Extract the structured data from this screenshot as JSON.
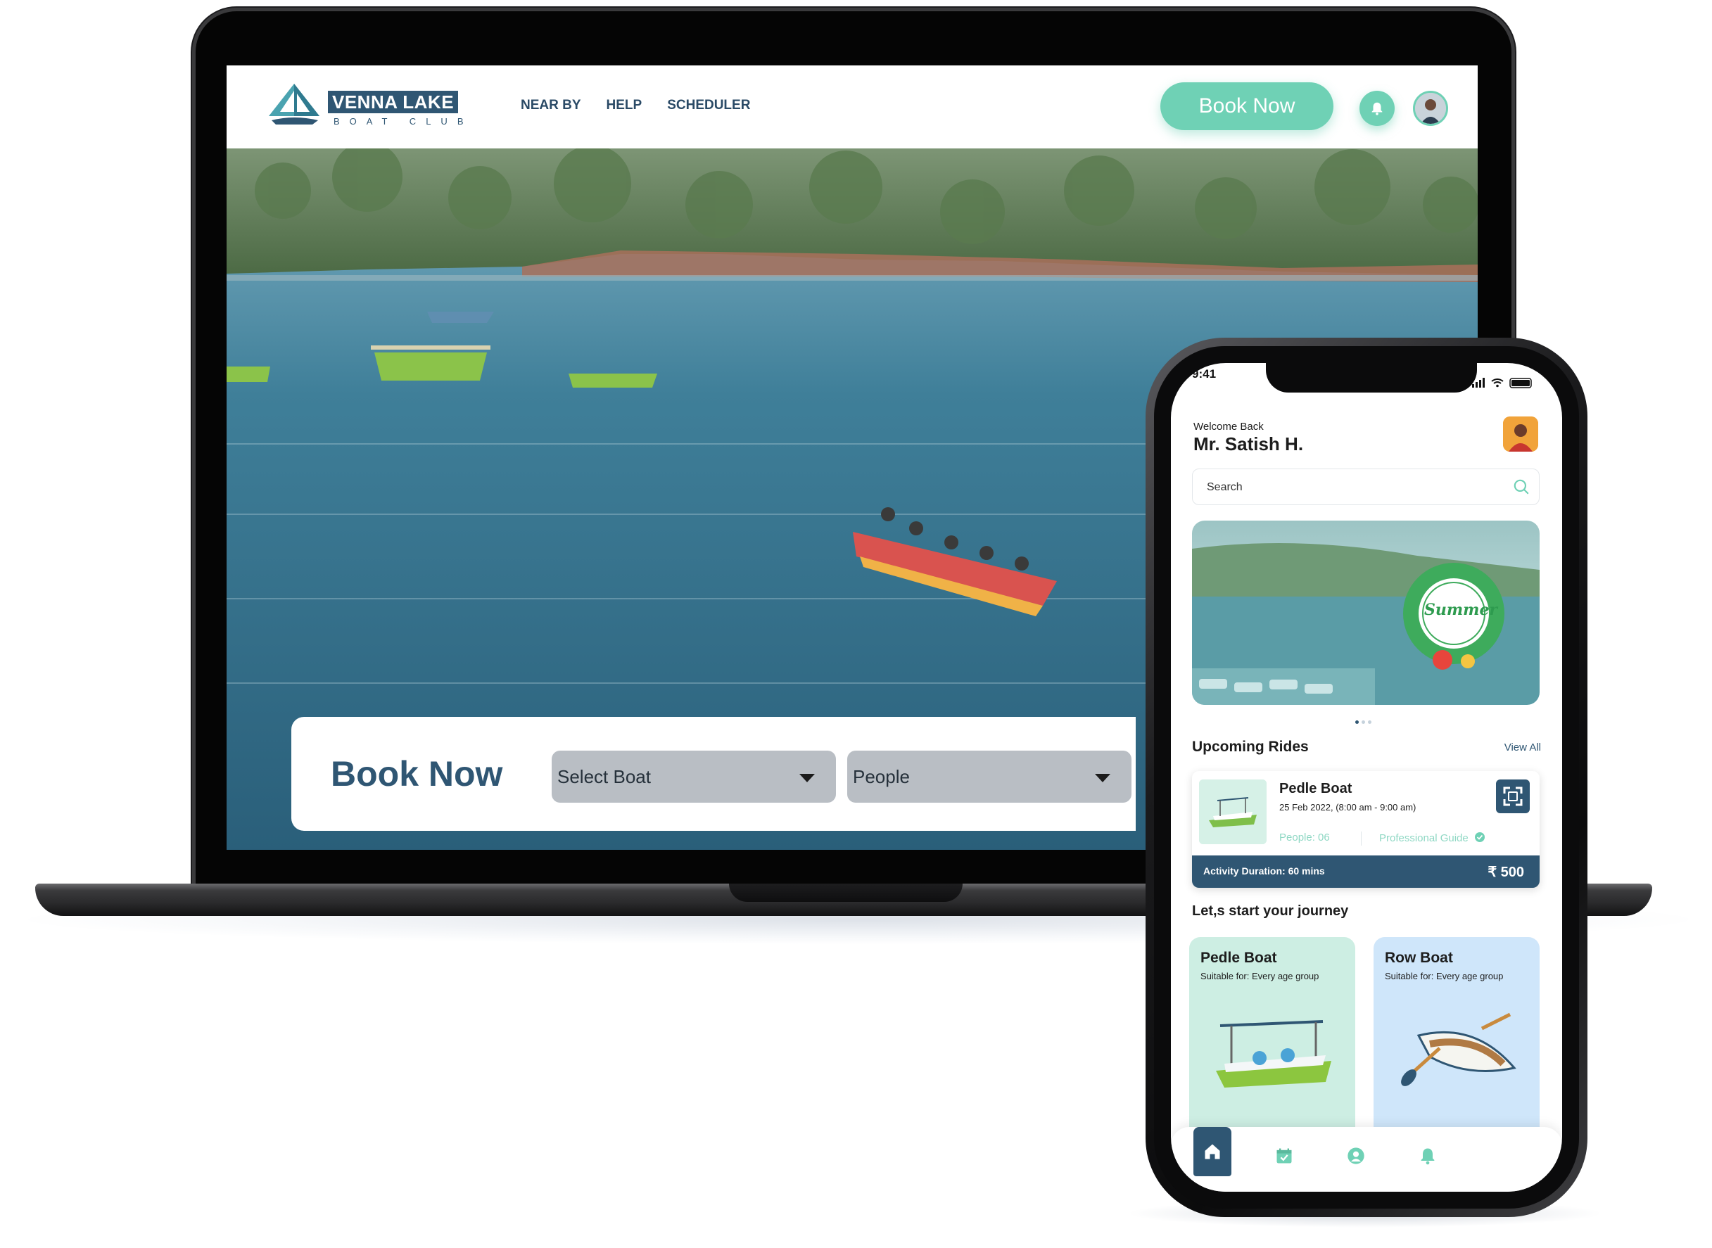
{
  "colors": {
    "brand_navy": "#2f5673",
    "accent_mint": "#6fd1b5",
    "select_gray": "#b9bec4"
  },
  "website": {
    "logo": {
      "title": "VENNA LAKE",
      "subtitle": "BOAT CLUB"
    },
    "nav": [
      {
        "label": "NEAR BY"
      },
      {
        "label": "HELP"
      },
      {
        "label": "SCHEDULER"
      }
    ],
    "header_cta": "Book Now",
    "icons": {
      "bell": "bell-icon",
      "avatar": "user-avatar"
    },
    "booking": {
      "title": "Book Now",
      "boat_select": "Select Boat",
      "people_select": "People"
    }
  },
  "mobile": {
    "status_time": "9:41",
    "welcome": "Welcome Back",
    "user_name": "Mr. Satish H.",
    "search_placeholder": "Search",
    "banner_badge": "Summer",
    "carousel": {
      "count": 3,
      "active": 0
    },
    "upcoming": {
      "title": "Upcoming Rides",
      "view_all": "View All",
      "ride": {
        "name": "Pedle Boat",
        "datetime": "25 Feb 2022, (8:00 am - 9:00 am)",
        "people": "People: 06",
        "guide": "Professional Guide",
        "duration": "Activity Duration: 60 mins",
        "price": "₹ 500"
      }
    },
    "journey": {
      "title": "Let,s start  your journey",
      "boats": [
        {
          "name": "Pedle Boat",
          "desc": "Suitable for: Every age group",
          "bg": "#cdeee3"
        },
        {
          "name": "Row Boat",
          "desc": "Suitable for: Every age group",
          "bg": "#cfe6fa"
        }
      ]
    },
    "tabs": [
      {
        "icon": "home-icon",
        "active": true
      },
      {
        "icon": "calendar-check-icon",
        "active": false
      },
      {
        "icon": "profile-icon",
        "active": false
      },
      {
        "icon": "bell-icon",
        "active": false
      }
    ]
  }
}
